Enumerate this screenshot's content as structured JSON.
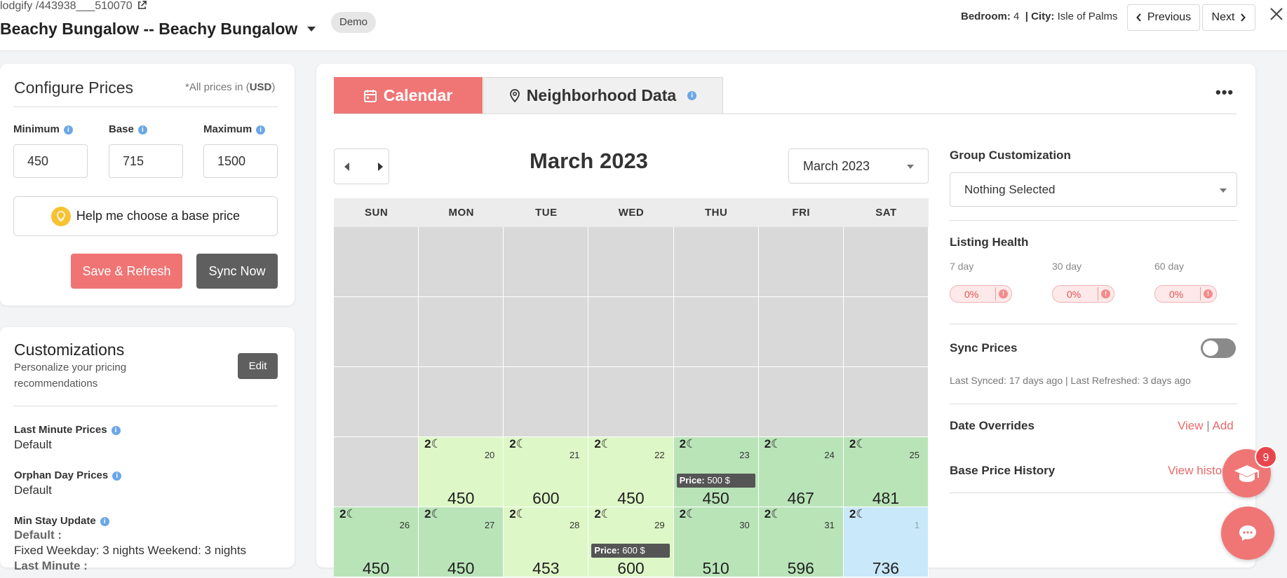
{
  "header": {
    "breadcrumb_prefix": "lodgify /",
    "listing_id": "443938___510070",
    "listing_title": "Beachy Bungalow -- Beachy Bungalow",
    "demo_badge": "Demo",
    "bedroom_label": "Bedroom:",
    "bedroom_value": "4",
    "city_label": "City:",
    "city_value": "Isle of Palms",
    "previous_label": "Previous",
    "next_label": "Next"
  },
  "configure": {
    "title": "Configure Prices",
    "note_prefix": "*All prices in (",
    "currency": "USD",
    "note_suffix": ")",
    "minimum_label": "Minimum",
    "base_label": "Base",
    "maximum_label": "Maximum",
    "minimum_value": "450",
    "base_value": "715",
    "maximum_value": "1500",
    "help_label": "Help me choose a base price",
    "save_label": "Save & Refresh",
    "sync_label": "Sync Now"
  },
  "customizations": {
    "title": "Customizations",
    "subtitle": "Personalize your pricing recommendations",
    "edit_label": "Edit",
    "items": [
      {
        "label": "Last Minute Prices",
        "value": "Default"
      },
      {
        "label": "Orphan Day Prices",
        "value": "Default"
      }
    ],
    "min_stay_label": "Min Stay Update",
    "min_stay_default_label": "Default :",
    "min_stay_default_value": "Fixed Weekday: 3 nights Weekend: 3 nights",
    "min_stay_last_minute_label": "Last Minute :"
  },
  "tabs": {
    "calendar": "Calendar",
    "neighborhood": "Neighborhood Data"
  },
  "calendar": {
    "title": "March 2023",
    "month_select": "March 2023",
    "weekdays": [
      "SUN",
      "MON",
      "TUE",
      "WED",
      "THU",
      "FRI",
      "SAT"
    ],
    "weeks": [
      [
        null,
        null,
        null,
        null,
        null,
        null,
        null
      ],
      [
        null,
        null,
        null,
        null,
        null,
        null,
        null
      ],
      [
        null,
        null,
        null,
        null,
        null,
        null,
        null
      ],
      [
        null,
        {
          "day": "20",
          "price": "450",
          "style": "light"
        },
        {
          "day": "21",
          "price": "600",
          "style": "light"
        },
        {
          "day": "22",
          "price": "450",
          "style": "light"
        },
        {
          "day": "23",
          "price": "450",
          "style": "green",
          "tag_label": "Price:",
          "tag_value": "500 $"
        },
        {
          "day": "24",
          "price": "467",
          "style": "green"
        },
        {
          "day": "25",
          "price": "481",
          "style": "green"
        }
      ],
      [
        {
          "day": "26",
          "price": "450",
          "style": "green"
        },
        {
          "day": "27",
          "price": "450",
          "style": "green"
        },
        {
          "day": "28",
          "price": "453",
          "style": "light"
        },
        {
          "day": "29",
          "price": "600",
          "style": "light",
          "tag_label": "Price:",
          "tag_value": "600 $"
        },
        {
          "day": "30",
          "price": "510",
          "style": "green"
        },
        {
          "day": "31",
          "price": "596",
          "style": "green"
        },
        {
          "day": "1",
          "price": "736",
          "style": "blue"
        }
      ]
    ]
  },
  "right_panel": {
    "group_label": "Group Customization",
    "group_select": "Nothing Selected",
    "listing_health_label": "Listing Health",
    "health": [
      {
        "label": "7 day",
        "value": "0%"
      },
      {
        "label": "30 day",
        "value": "0%"
      },
      {
        "label": "60 day",
        "value": "0%"
      }
    ],
    "sync_prices_label": "Sync Prices",
    "sync_status": "Last Synced: 17 days ago | Last Refreshed: 3 days ago",
    "date_overrides_label": "Date Overrides",
    "view_label": "View",
    "add_label": "Add",
    "separator": "|",
    "base_history_label": "Base Price History",
    "view_history_label": "View history"
  },
  "floating": {
    "badge_count": "9"
  },
  "colors": {
    "accent": "#f07575",
    "dark_button": "#5f5f5f",
    "cell_light": "#ddf7c7",
    "cell_green": "#b9e4b8",
    "cell_blue": "#c9e8f9",
    "cell_gray": "#d9d9d9"
  }
}
